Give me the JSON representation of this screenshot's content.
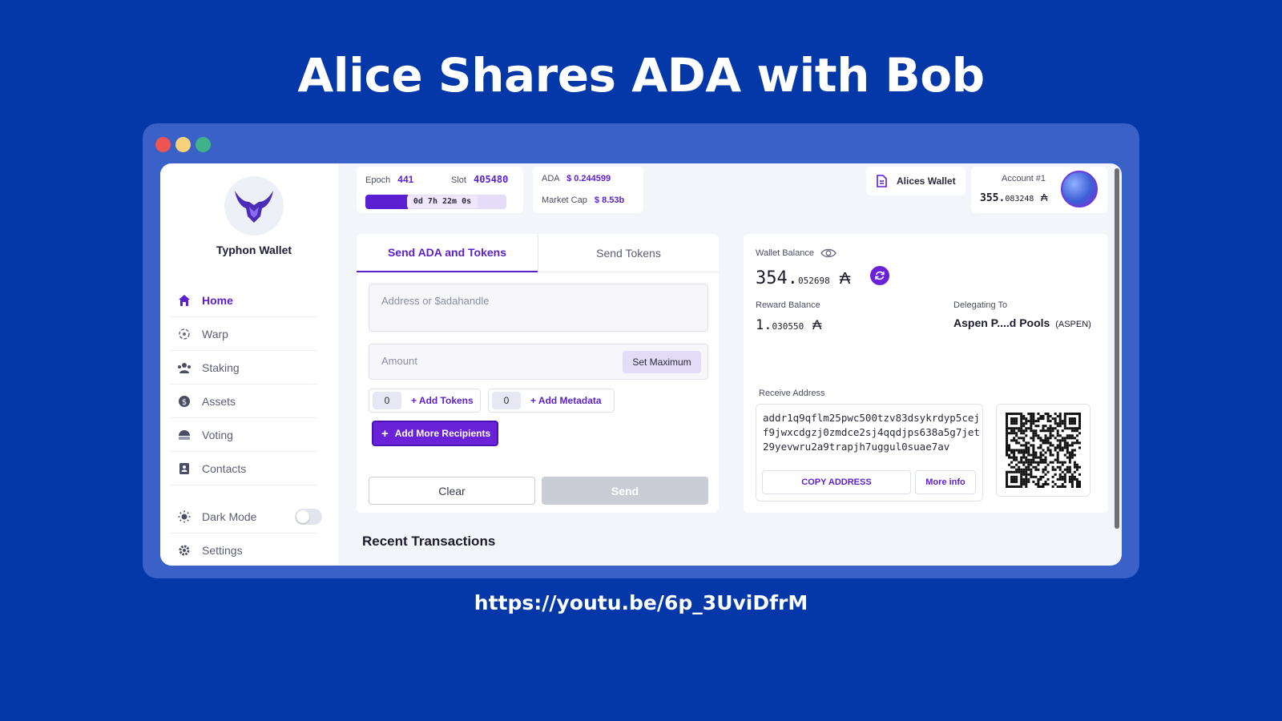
{
  "slide": {
    "title": "Alice Shares ADA with Bob",
    "link": "https://youtu.be/6p_3UviDfrM"
  },
  "sidebar": {
    "brand": "Typhon Wallet",
    "items": [
      {
        "label": "Home",
        "icon": "home-icon"
      },
      {
        "label": "Warp",
        "icon": "warp-icon"
      },
      {
        "label": "Staking",
        "icon": "staking-icon"
      },
      {
        "label": "Assets",
        "icon": "assets-icon"
      },
      {
        "label": "Voting",
        "icon": "voting-icon"
      },
      {
        "label": "Contacts",
        "icon": "contacts-icon"
      },
      {
        "label": "Dark Mode",
        "icon": "sun-icon"
      },
      {
        "label": "Settings",
        "icon": "gear-icon"
      }
    ]
  },
  "header": {
    "epoch_label": "Epoch",
    "epoch": "441",
    "slot_label": "Slot",
    "slot": "405480",
    "countdown": "0d 7h 22m 0s",
    "epoch_progress": 0.3,
    "ada_label": "ADA",
    "ada_price": "$ 0.244599",
    "mcap_label": "Market Cap",
    "mcap": "$ 8.53b",
    "wallet_name": "Alices Wallet",
    "account_label": "Account #1",
    "account_balance_int": "355.",
    "account_balance_dec": "083248"
  },
  "send": {
    "tab_active": "Send ADA and Tokens",
    "tab_inactive": "Send Tokens",
    "address_placeholder": "Address or $adahandle",
    "amount_placeholder": "Amount",
    "set_max": "Set Maximum",
    "tokens_count": "0",
    "add_tokens": "+ Add Tokens",
    "metadata_count": "0",
    "add_metadata": "+ Add Metadata",
    "add_recipients": "Add More Recipients",
    "clear": "Clear",
    "send": "Send"
  },
  "balance": {
    "wallet_label": "Wallet Balance",
    "wallet_int": "354.",
    "wallet_dec": "052698",
    "reward_label": "Reward Balance",
    "reward_int": "1.",
    "reward_dec": "030550",
    "delegating_label": "Delegating To",
    "pool": "Aspen P....d Pools",
    "pool_ticker": "(ASPEN)",
    "receive_label": "Receive Address",
    "address": "addr1q9qflm25pwc500tzv83dsykrdyp5cejf9jwxcdgzj0zmdce2sj4qqdjps638a5g7jet29yevwru2a9trapjh7uggul0suae7av",
    "copy": "COPY ADDRESS",
    "more_info": "More info",
    "ada_symbol": "₳"
  },
  "recent_title": "Recent Transactions",
  "colors": {
    "background": "#0437a7",
    "accent": "#5a1fd1",
    "window": "#3a61c7"
  }
}
